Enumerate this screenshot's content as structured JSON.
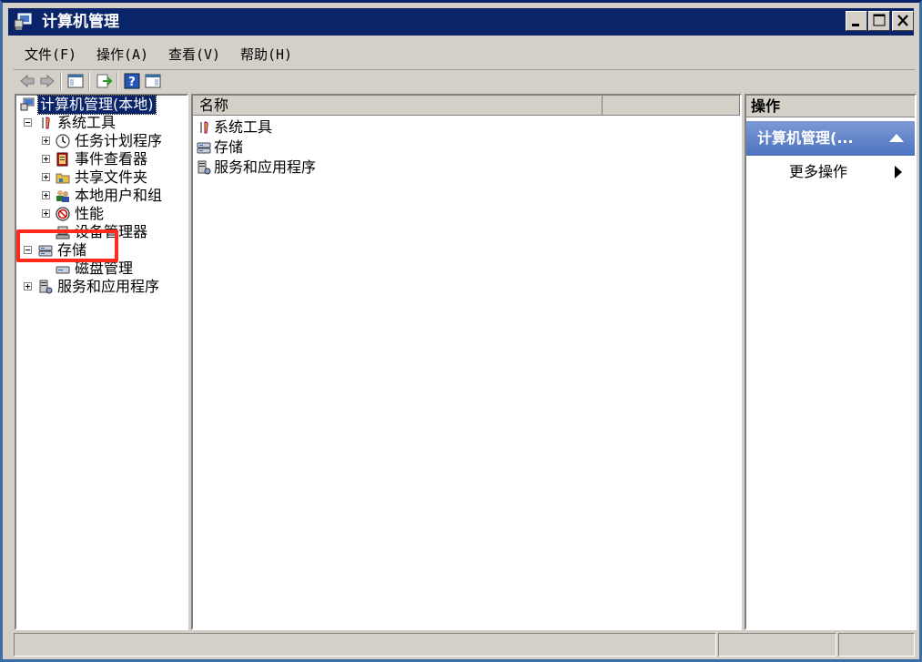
{
  "window": {
    "title": "计算机管理"
  },
  "menu": {
    "items": [
      {
        "label": "文件(F)"
      },
      {
        "label": "操作(A)"
      },
      {
        "label": "查看(V)"
      },
      {
        "label": "帮助(H)"
      }
    ]
  },
  "tree": {
    "root": "计算机管理(本地)",
    "system_tools": "系统工具",
    "task_scheduler": "任务计划程序",
    "event_viewer": "事件查看器",
    "shared_folders": "共享文件夹",
    "local_users": "本地用户和组",
    "performance": "性能",
    "device_manager": "设备管理器",
    "storage": "存储",
    "disk_management": "磁盘管理",
    "services_apps": "服务和应用程序"
  },
  "list": {
    "column_name": "名称",
    "rows": [
      {
        "label": "系统工具",
        "icon": "tools-icon"
      },
      {
        "label": "存储",
        "icon": "storage-icon"
      },
      {
        "label": "服务和应用程序",
        "icon": "services-icon"
      }
    ]
  },
  "actions": {
    "header": "操作",
    "group": "计算机管理(...",
    "more": "更多操作"
  },
  "colors": {
    "titlebar": "#0a246a",
    "highlight": "#ff2a1a",
    "action_group": "#5a7ec8"
  }
}
